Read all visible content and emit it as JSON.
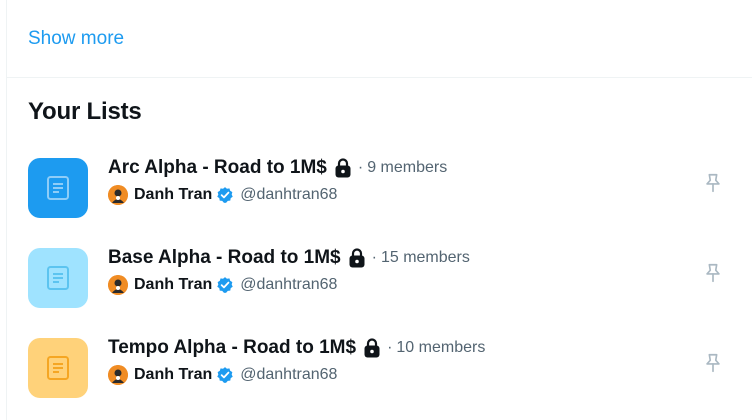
{
  "show_more": "Show more",
  "section_title": "Your Lists",
  "colors": {
    "link": "#1d9bf0",
    "secondary_text": "#536471",
    "pin": "#aab8c2"
  },
  "lists": [
    {
      "name": "Arc Alpha - Road to 1M$",
      "separator": "·",
      "members": "9 members",
      "icon_bg": "#1d9bf0",
      "icon_fg": "#8ecdf8",
      "owner": {
        "name": "Danh Tran",
        "handle": "@danhtran68"
      },
      "icons": [
        "list-icon",
        "lock-icon",
        "verified-icon",
        "pin-icon"
      ]
    },
    {
      "name": "Base Alpha - Road to 1M$",
      "separator": "·",
      "members": "15 members",
      "icon_bg": "#9fe3ff",
      "icon_fg": "#5cc4f0",
      "owner": {
        "name": "Danh Tran",
        "handle": "@danhtran68"
      },
      "icons": [
        "list-icon",
        "lock-icon",
        "verified-icon",
        "pin-icon"
      ]
    },
    {
      "name": "Tempo Alpha - Road to 1M$",
      "separator": "·",
      "members": "10 members",
      "icon_bg": "#ffd27a",
      "icon_fg": "#f5a623",
      "owner": {
        "name": "Danh Tran",
        "handle": "@danhtran68"
      },
      "icons": [
        "list-icon",
        "lock-icon",
        "verified-icon",
        "pin-icon"
      ]
    }
  ]
}
